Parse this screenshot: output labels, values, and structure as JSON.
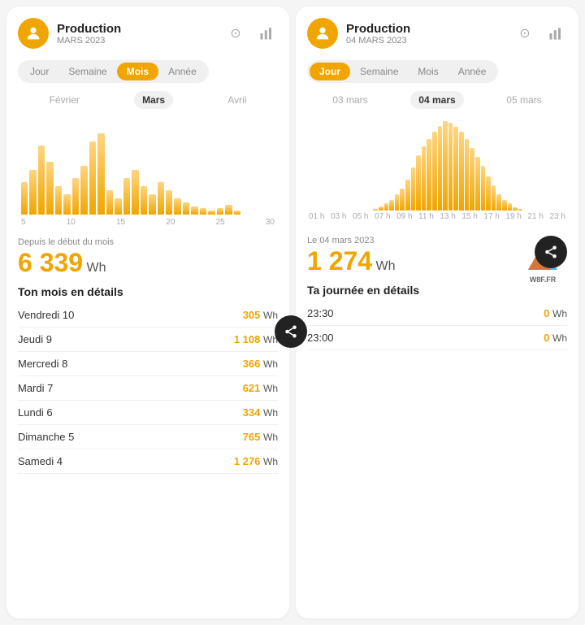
{
  "left_panel": {
    "title": "Production",
    "subtitle": "MARS 2023",
    "tabs": [
      {
        "label": "Jour",
        "active": false
      },
      {
        "label": "Semaine",
        "active": false
      },
      {
        "label": "Mois",
        "active": true
      },
      {
        "label": "Année",
        "active": false
      }
    ],
    "periods": [
      {
        "label": "Février",
        "active": false
      },
      {
        "label": "Mars",
        "active": true
      },
      {
        "label": "Avril",
        "active": false
      }
    ],
    "chart_x_labels": [
      "5",
      "10",
      "15",
      "20",
      "25",
      "30"
    ],
    "stat_label": "Depuis le début du mois",
    "stat_value": "6 339",
    "stat_unit": "Wh",
    "details_title": "Ton mois en détails",
    "details": [
      {
        "day": "Vendredi 10",
        "value": "305",
        "unit": "Wh"
      },
      {
        "day": "Jeudi 9",
        "value": "1 108",
        "unit": "Wh"
      },
      {
        "day": "Mercredi 8",
        "value": "366",
        "unit": "Wh"
      },
      {
        "day": "Mardi 7",
        "value": "621",
        "unit": "Wh"
      },
      {
        "day": "Lundi 6",
        "value": "334",
        "unit": "Wh"
      },
      {
        "day": "Dimanche 5",
        "value": "765",
        "unit": "Wh"
      },
      {
        "day": "Samedi 4",
        "value": "1 276",
        "unit": "Wh"
      }
    ]
  },
  "right_panel": {
    "title": "Production",
    "subtitle": "04 MARS 2023",
    "tabs": [
      {
        "label": "Jour",
        "active": true
      },
      {
        "label": "Semaine",
        "active": false
      },
      {
        "label": "Mois",
        "active": false
      },
      {
        "label": "Année",
        "active": false
      }
    ],
    "periods": [
      {
        "label": "03 mars",
        "active": false
      },
      {
        "label": "04 mars",
        "active": true
      },
      {
        "label": "05 mars",
        "active": false
      }
    ],
    "chart_x_labels": [
      "01 h",
      "03 h",
      "05 h",
      "07 h",
      "09 h",
      "11 h",
      "13 h",
      "15 h",
      "17 h",
      "19 h",
      "21 h",
      "23 h"
    ],
    "stat_label": "Le 04 mars 2023",
    "stat_value": "1 274",
    "stat_unit": "Wh",
    "details_title": "Ta journée en détails",
    "details": [
      {
        "time": "23:30",
        "value": "0",
        "unit": "Wh"
      },
      {
        "time": "23:00",
        "value": "0",
        "unit": "Wh"
      }
    ],
    "watermark": "W8F.FR"
  },
  "share_label": "share"
}
